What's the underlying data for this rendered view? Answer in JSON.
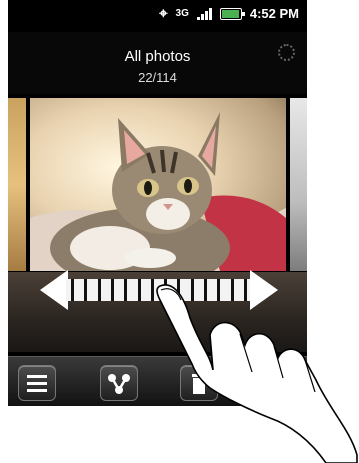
{
  "status_bar": {
    "time": "4:52 PM",
    "network": "3G",
    "icons": [
      "gps-icon",
      "network-3g-icon",
      "signal-icon",
      "battery-icon"
    ]
  },
  "header": {
    "title": "All photos",
    "counter": "22/114"
  },
  "scrubber": {
    "icon": "scrubber-arrows-icon"
  },
  "toolbar": {
    "buttons": [
      "menu-icon",
      "share-icon",
      "delete-icon"
    ]
  },
  "colors": {
    "background": "#000000",
    "text": "#ffffff",
    "battery": "#4caf50"
  }
}
